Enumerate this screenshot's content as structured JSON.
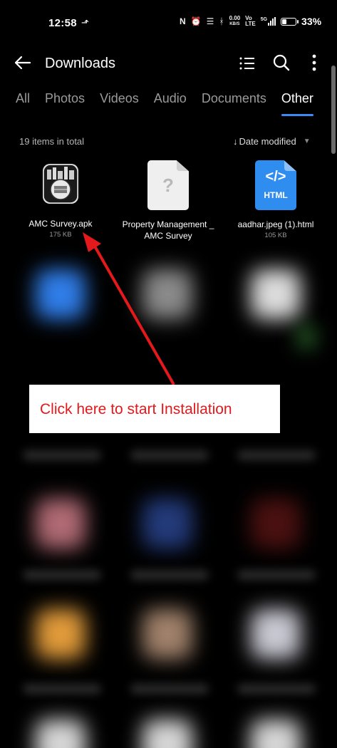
{
  "status_bar": {
    "time": "12:58",
    "net_speed": "0.00",
    "net_unit": "KB/S",
    "volte_top": "Vo",
    "volte_bottom": "LTE",
    "signal_tag": "5G",
    "battery_percent": "33%",
    "battery_level": 0.33
  },
  "app_bar": {
    "title": "Downloads"
  },
  "tabs": [
    {
      "label": "All"
    },
    {
      "label": "Photos"
    },
    {
      "label": "Videos"
    },
    {
      "label": "Audio"
    },
    {
      "label": "Documents"
    },
    {
      "label": "Other",
      "active": true
    }
  ],
  "list_meta": {
    "item_count": "19 items in total",
    "sort_label": "Date modified"
  },
  "files": [
    {
      "name": "AMC Survey.apk",
      "size": "175 KB",
      "icon": "apk-icon"
    },
    {
      "name": "Property Management _ AMC Survey",
      "size": "",
      "icon": "unknown-file-icon"
    },
    {
      "name": "aadhar.jpeg (1).html",
      "size": "105 KB",
      "icon": "html-file-icon",
      "icon_code": "</>",
      "icon_label": "HTML"
    }
  ],
  "annotation": {
    "text": "Click here to start Installation",
    "color": "#e3191c"
  },
  "colors": {
    "accent": "#3d8af7",
    "background": "#000000",
    "html_icon": "#2f8df0"
  }
}
